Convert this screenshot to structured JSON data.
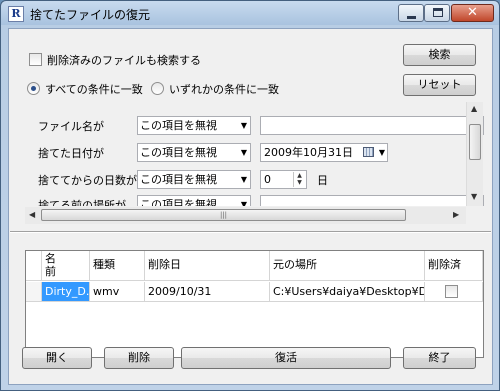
{
  "window": {
    "app_icon_letter": "R",
    "title": "捨てたファイルの復元",
    "close_glyph": "✕"
  },
  "options": {
    "search_deleted_label": "削除済みのファイルも検索する",
    "search_deleted_checked": false,
    "match_all_label": "すべての条件に一致",
    "match_any_label": "いずれかの条件に一致",
    "selected_match": "all"
  },
  "buttons": {
    "search": "検索",
    "reset": "リセット",
    "open": "開く",
    "delete": "削除",
    "restore": "復活",
    "exit": "終了"
  },
  "conditions": [
    {
      "label": "ファイル名が",
      "mode": "この項目を無視",
      "value": ""
    },
    {
      "label": "捨てた日付が",
      "mode": "この項目を無視",
      "value": "2009年10月31日"
    },
    {
      "label": "捨ててからの日数が",
      "mode": "この項目を無視",
      "value": "0",
      "suffix": "日"
    },
    {
      "label": "捨てる前の場所が",
      "mode": "この項目を無視",
      "value": ""
    }
  ],
  "results": {
    "columns": [
      "名前",
      "種類",
      "削除日",
      "元の場所",
      "削除済"
    ],
    "rows": [
      {
        "name": "Dirty_D...",
        "type": "wmv",
        "deleted_date": "2009/10/31",
        "original_location": "C:¥Users¥daiya¥Desktop¥Di...",
        "deleted": false
      }
    ]
  },
  "icons": {
    "dropdown": "chevron-down-icon",
    "calendar": "calendar-icon",
    "spin": "spin-updown-icon"
  }
}
